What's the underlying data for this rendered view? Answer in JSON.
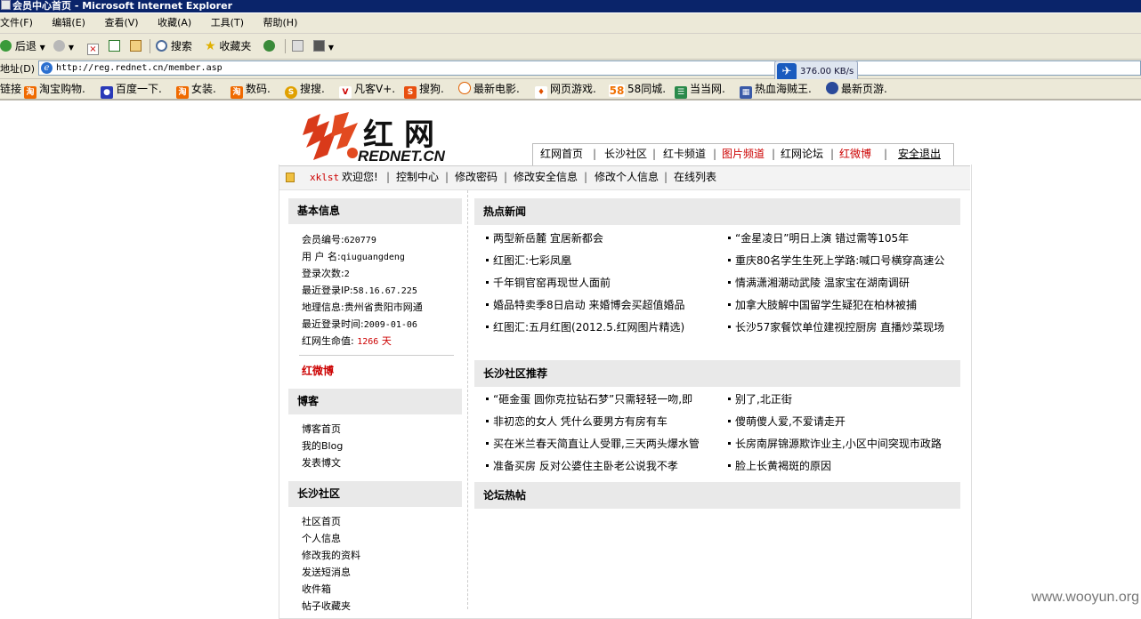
{
  "window": {
    "title": "会员中心首页 - Microsoft Internet Explorer"
  },
  "menu": [
    "文件(F)",
    "编辑(E)",
    "查看(V)",
    "收藏(A)",
    "工具(T)",
    "帮助(H)"
  ],
  "toolbar": {
    "back": "后退",
    "search": "搜索",
    "favorites": "收藏夹"
  },
  "address": {
    "label": "地址(D)",
    "url": "http://reg.rednet.cn/member.asp"
  },
  "download_speed": "376.00 KB/s",
  "links": {
    "label": "链接",
    "items": [
      "淘宝购物.",
      "百度一下.",
      "女装.",
      "数码.",
      "搜搜.",
      "凡客V+.",
      "搜狗.",
      "最新电影.",
      "网页游戏.",
      "58同城.",
      "当当网.",
      "热血海贼王.",
      "最新页游."
    ]
  },
  "logo": {
    "chars": "红网",
    "domain": "REDNET.CN"
  },
  "topnav": [
    "红网首页",
    "长沙社区",
    "红卡频道",
    "图片频道",
    "红网论坛",
    "红微博",
    "安全退出"
  ],
  "userbar": {
    "username": "xklst",
    "welcome": "欢迎您!",
    "links": [
      "控制中心",
      "修改密码",
      "修改安全信息",
      "修改个人信息",
      "在线列表"
    ]
  },
  "basic_info": {
    "title": "基本信息",
    "rows": [
      {
        "label": "会员编号:",
        "value": "620779"
      },
      {
        "label": "用 户 名:",
        "value": "qiuguangdeng"
      },
      {
        "label": "登录次数:",
        "value": "2"
      },
      {
        "label": "最近登录IP:",
        "value": "58.16.67.225"
      },
      {
        "label": "地理信息:",
        "value": "贵州省贵阳市网通"
      },
      {
        "label": "最近登录时间:",
        "value": "2009-01-06"
      }
    ],
    "life_label": "红网生命值:",
    "life_value": "1266",
    "life_unit": "天",
    "weibo": "红微博"
  },
  "blog": {
    "title": "博客",
    "links": [
      "博客首页",
      "我的Blog",
      "发表博文"
    ]
  },
  "community": {
    "title": "长沙社区",
    "links": [
      "社区首页",
      "个人信息",
      "修改我的资料",
      "发送短消息",
      "收件箱",
      "帖子收藏夹"
    ]
  },
  "hot_news": {
    "title": "热点新闻",
    "left": [
      "两型新岳麓 宜居新都会",
      "红图汇:七彩凤凰",
      "千年铜官窑再现世人面前",
      "婚品特卖季8日启动 来婚博会买超值婚品",
      "红图汇:五月红图(2012.5.红网图片精选)"
    ],
    "right": [
      "“金星凌日”明日上演 错过需等105年",
      "重庆80名学生生死上学路:喊口号横穿高速公",
      "情满潇湘潮动武陵 温家宝在湖南调研",
      "加拿大肢解中国留学生疑犯在柏林被捕",
      "长沙57家餐饮单位建视控厨房 直播炒菜现场"
    ]
  },
  "community_rec": {
    "title": "长沙社区推荐",
    "left": [
      "“砸金蛋 圆你克拉钻石梦”只需轻轻一吻,即",
      "非初恋的女人 凭什么要男方有房有车",
      "买在米兰春天简直让人受罪,三天两头爆水管",
      "准备买房 反对公婆住主卧老公说我不孝"
    ],
    "right": [
      "别了,北正街",
      "傻萌傻人爱,不爱请走开",
      "长房南屏锦源欺诈业主,小区中间突现市政路",
      "脸上长黄褐斑的原因"
    ]
  },
  "forum": {
    "title": "论坛热帖"
  },
  "watermark": "www.wooyun.org",
  "colors": {
    "ie_title": "#0a246a",
    "chrome": "#ece9d8",
    "accent_red": "#cc0000"
  }
}
